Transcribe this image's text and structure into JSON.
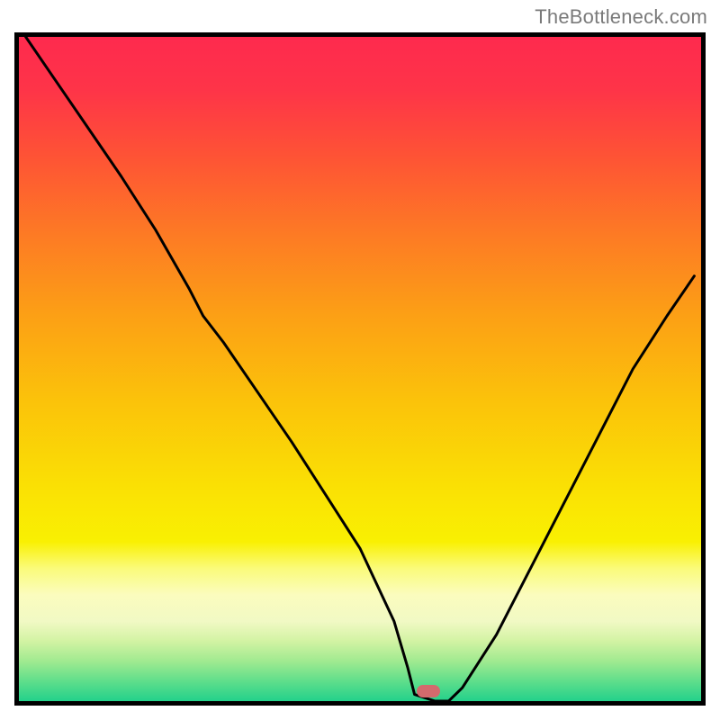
{
  "watermark": "TheBottleneck.com",
  "chart_data": {
    "type": "line",
    "title": "",
    "xlabel": "",
    "ylabel": "",
    "xlim": [
      0,
      100
    ],
    "ylim": [
      0,
      100
    ],
    "x": [
      1,
      5,
      10,
      15,
      20,
      25,
      27,
      30,
      35,
      40,
      45,
      50,
      55,
      57,
      58,
      61,
      63,
      65,
      70,
      75,
      80,
      85,
      90,
      95,
      99
    ],
    "y": [
      100,
      94,
      86.5,
      79,
      71,
      62,
      58,
      54,
      46.5,
      39,
      31,
      23,
      12,
      5,
      1,
      0,
      0,
      2,
      10,
      20,
      30,
      40,
      50,
      58,
      64
    ],
    "marker": {
      "x_frac": 0.6,
      "y_frac": 0.985,
      "color": "#d36a6d"
    },
    "gradient_stops": [
      {
        "pos": 0.0,
        "color": "#fe2a4e"
      },
      {
        "pos": 0.08,
        "color": "#fe3448"
      },
      {
        "pos": 0.18,
        "color": "#fe5335"
      },
      {
        "pos": 0.3,
        "color": "#fd7b24"
      },
      {
        "pos": 0.42,
        "color": "#fca015"
      },
      {
        "pos": 0.55,
        "color": "#fbc30a"
      },
      {
        "pos": 0.68,
        "color": "#fae104"
      },
      {
        "pos": 0.76,
        "color": "#f9f002"
      },
      {
        "pos": 0.8,
        "color": "#fafb7a"
      },
      {
        "pos": 0.84,
        "color": "#fbfcbe"
      },
      {
        "pos": 0.88,
        "color": "#f1f9c4"
      },
      {
        "pos": 0.91,
        "color": "#d2f3a3"
      },
      {
        "pos": 0.94,
        "color": "#a0ea90"
      },
      {
        "pos": 0.97,
        "color": "#5fde8b"
      },
      {
        "pos": 1.0,
        "color": "#23d18b"
      }
    ]
  }
}
